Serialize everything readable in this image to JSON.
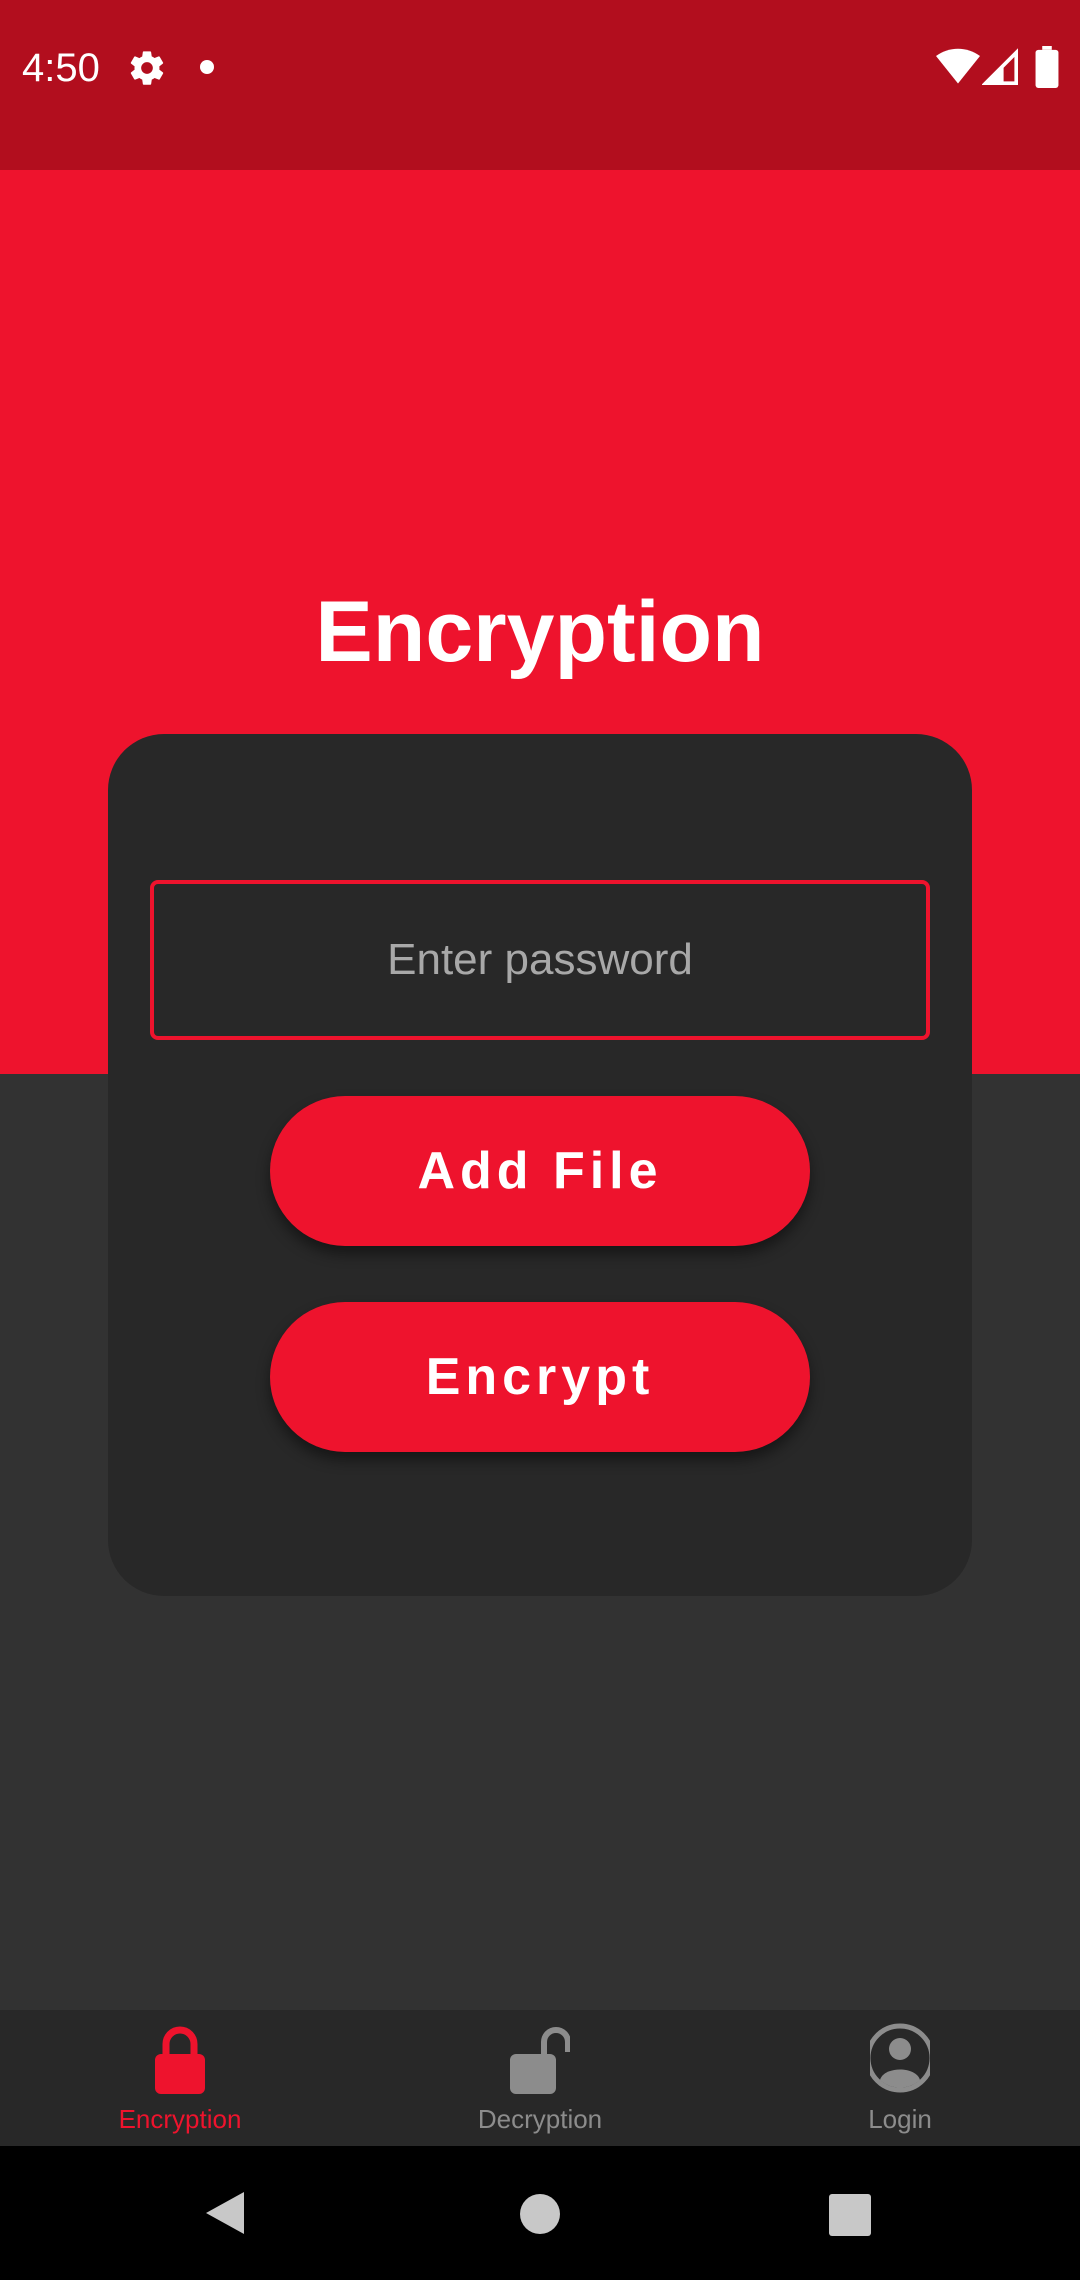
{
  "status_bar": {
    "time": "4:50",
    "background": "#b20e1e",
    "icons": [
      "gear-icon",
      "notification-dot-icon",
      "wifi-icon",
      "signal-icon",
      "battery-icon"
    ]
  },
  "hero": {
    "title": "Encryption",
    "background": "#ee132d"
  },
  "form": {
    "password_placeholder": "Enter password",
    "add_file_label": "Add File",
    "encrypt_label": "Encrypt"
  },
  "bottom_nav": {
    "items": [
      {
        "label": "Encryption",
        "icon": "lock-icon",
        "active": true
      },
      {
        "label": "Decryption",
        "icon": "unlock-icon",
        "active": false
      },
      {
        "label": "Login",
        "icon": "account-icon",
        "active": false
      }
    ],
    "active_color": "#ee132d",
    "inactive_color": "#8c8c8c"
  },
  "system_nav": {
    "icons": [
      "back-icon",
      "home-icon",
      "recents-icon"
    ]
  },
  "colors": {
    "accent": "#ee132d",
    "card": "#282828",
    "background": "#323232"
  }
}
